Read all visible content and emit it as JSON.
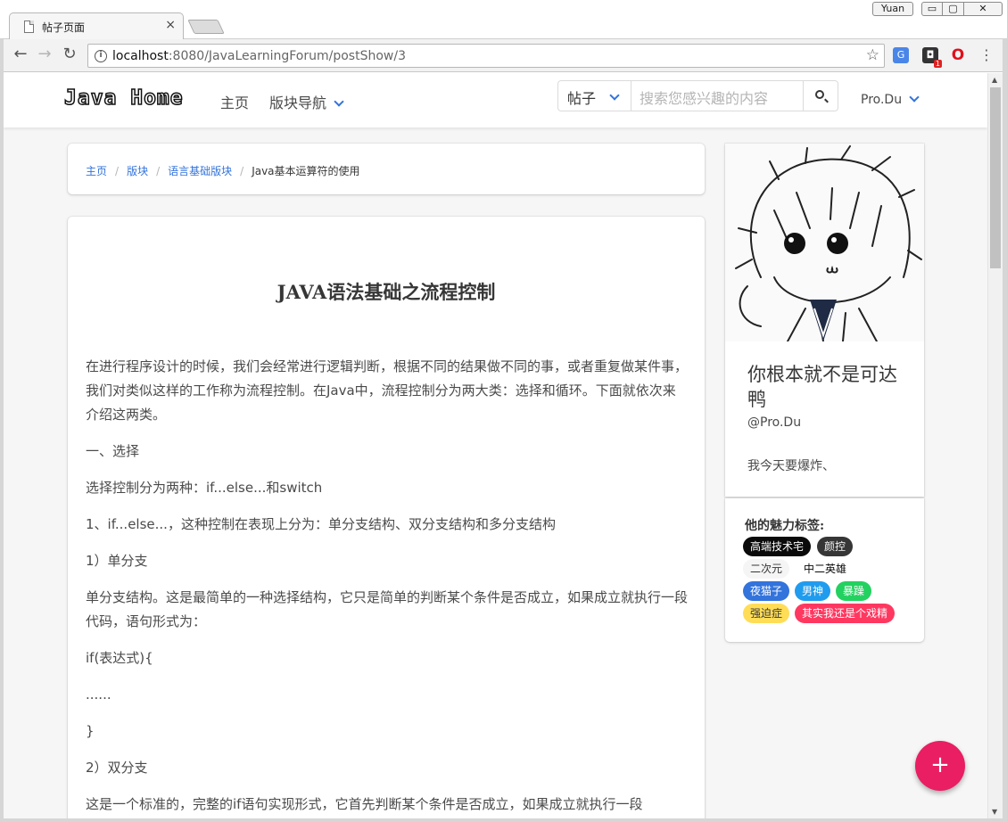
{
  "browser": {
    "tab_title": "帖子页面",
    "tab_close": "×",
    "user_button": "Yuan",
    "win_min": "▭",
    "win_max": "▢",
    "win_close": "✕",
    "url_host": "localhost",
    "url_rest": ":8080/JavaLearningForum/postShow/3",
    "ext_badge": "1"
  },
  "navbar": {
    "logo": "Java Home",
    "home_label": "主页",
    "boards_label": "版块导航",
    "search_type": "帖子",
    "search_placeholder": "搜索您感兴趣的内容",
    "user_label": "Pro.Du"
  },
  "breadcrumb": {
    "items": [
      "主页",
      "版块",
      "语言基础版块"
    ],
    "current": "Java基本运算符的使用"
  },
  "post": {
    "title": "JAVA语法基础之流程控制",
    "paragraphs": [
      "在进行程序设计的时候，我们会经常进行逻辑判断，根据不同的结果做不同的事，或者重复做某件事，我们对类似这样的工作称为流程控制。在Java中，流程控制分为两大类：选择和循环。下面就依次来介绍这两类。",
      "一、选择",
      "选择控制分为两种：if...else...和switch",
      "1、if...else...，这种控制在表现上分为：单分支结构、双分支结构和多分支结构",
      "1）单分支",
      "单分支结构。这是最简单的一种选择结构，它只是简单的判断某个条件是否成立，如果成立就执行一段代码，语句形式为：",
      "if(表达式){",
      "......",
      "}",
      "2）双分支",
      "这是一个标准的，完整的if语句实现形式，它首先判断某个条件是否成立，如果成立就执行一段"
    ]
  },
  "profile": {
    "name": "你根本就不是可达鸭",
    "handle": "@Pro.Du",
    "motto": "我今天要爆炸、"
  },
  "tags": {
    "title": "他的魅力标签:",
    "items": [
      {
        "label": "高端技术宅",
        "bg": "#0a0a0a",
        "fg": "#ffffff"
      },
      {
        "label": "颜控",
        "bg": "#363636",
        "fg": "#f5f5f5"
      },
      {
        "label": "二次元",
        "bg": "#f5f5f5",
        "fg": "#363636"
      },
      {
        "label": "中二英雄",
        "bg": "#ffffff",
        "fg": "#0a0a0a"
      },
      {
        "label": "夜猫子",
        "bg": "#3273dc",
        "fg": "#ffffff"
      },
      {
        "label": "男神",
        "bg": "#209cee",
        "fg": "#ffffff"
      },
      {
        "label": "暴躁",
        "bg": "#23d160",
        "fg": "#ffffff"
      },
      {
        "label": "强迫症",
        "bg": "#ffdd57",
        "fg": "#363636"
      },
      {
        "label": "其实我还是个戏精",
        "bg": "#ff3860",
        "fg": "#ffffff"
      }
    ]
  },
  "fab_label": "+"
}
